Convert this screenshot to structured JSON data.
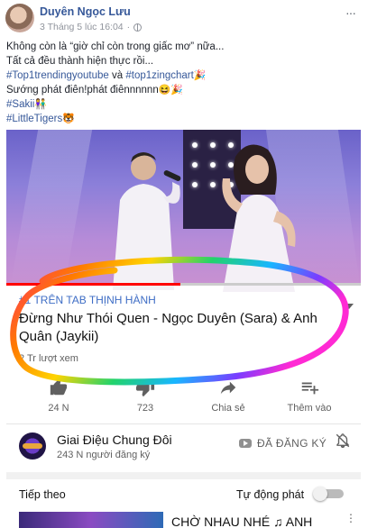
{
  "post": {
    "author": "Duyên Ngọc Lưu",
    "timestamp": "3 Tháng 5 lúc 16:04",
    "more_label": "···",
    "lines": [
      {
        "text": "Không còn là “giờ chỉ còn trong giấc mơ” nữa..."
      },
      {
        "text": "Tất cả đều thành hiện thực rồi..."
      },
      {
        "tag1": "#Top1trendingyoutube",
        "mid": " và ",
        "tag2": "#top1zingchart",
        "emoji": "🎉"
      },
      {
        "text": "Sướng phát điên!phát điênnnnnn",
        "emoji": "😆🎉"
      },
      {
        "tag": "#Sakii",
        "emoji": "👫"
      },
      {
        "tag": "#LittleTigers",
        "emoji": "🐯"
      }
    ]
  },
  "video": {
    "progress_fraction": 0.49,
    "trending_label": "#1 TRÊN TAB THỊNH HÀNH",
    "title": "Đừng Như Thói Quen - Ngọc Duyên (Sara) & Anh Quân (Jaykii)",
    "views": "2 Tr lượt xem",
    "actions": {
      "like": {
        "icon": "thumbs-up-icon",
        "label": "24 N"
      },
      "dislike": {
        "icon": "thumbs-down-icon",
        "label": "723"
      },
      "share": {
        "icon": "share-icon",
        "label": "Chia sẻ"
      },
      "add": {
        "icon": "playlist-add-icon",
        "label": "Thêm vào"
      }
    }
  },
  "channel": {
    "name": "Giai Điệu Chung Đôi",
    "subscribers": "243 N người đăng ký",
    "subscribed_label": "ĐÃ ĐĂNG KÝ"
  },
  "up_next": {
    "label": "Tiếp theo",
    "autoplay_label": "Tự động phát",
    "autoplay_on": false,
    "next_title": "CHỜ NHAU NHÉ ♫ ANH"
  },
  "colors": {
    "link": "#365899",
    "trending": "#3e6dc5",
    "progress": "#ff0000"
  }
}
